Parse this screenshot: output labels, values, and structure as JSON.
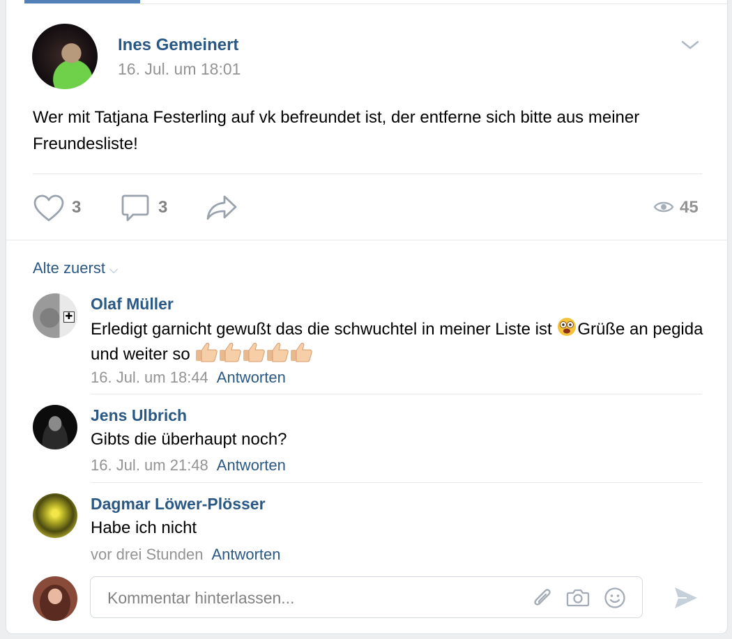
{
  "post": {
    "author": "Ines Gemeinert",
    "date": "16. Jul. um 18:01",
    "text": "Wer mit Tatjana Festerling auf vk befreundet ist, der entferne sich bitte aus meiner Freundesliste!",
    "likes": "3",
    "comments": "3",
    "views": "45"
  },
  "sort_label": "Alte zuerst",
  "comments": [
    {
      "name": "Olaf Müller",
      "text": "Erledigt garnicht gewußt das die schwuchtel in meiner Liste ist ",
      "text2": "Grüße an pegida und weiter so ",
      "time": "16. Jul. um 18:44",
      "reply": "Antworten"
    },
    {
      "name": "Jens Ulbrich",
      "text": "Gibts die überhaupt noch?",
      "time": "16. Jul. um 21:48",
      "reply": "Antworten"
    },
    {
      "name": "Dagmar Löwer-Plösser",
      "text": "Habe ich nicht",
      "time": "vor drei Stunden",
      "reply": "Antworten"
    }
  ],
  "composer": {
    "placeholder": "Kommentar hinterlassen..."
  },
  "colors": {
    "link": "#2a5885",
    "muted": "#939393",
    "accent": "#5181b8",
    "icon": "#99a2ad"
  },
  "icons": [
    "chevron-down-icon",
    "heart-icon",
    "comment-icon",
    "share-icon",
    "eye-icon",
    "paperclip-icon",
    "camera-icon",
    "smile-icon",
    "send-icon",
    "surprised-emoji",
    "thumbs-up-emoji"
  ]
}
